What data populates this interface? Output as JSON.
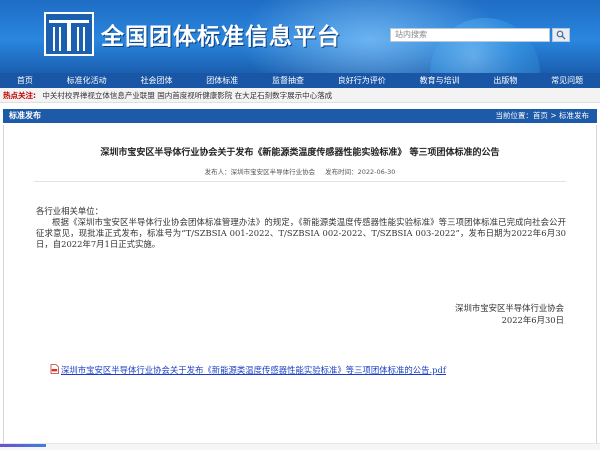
{
  "header": {
    "site_title": "全国团体标准信息平台",
    "search_placeholder": "站内搜索"
  },
  "nav": [
    "首页",
    "标准化活动",
    "社会团体",
    "团体标准",
    "监督抽查",
    "良好行为评价",
    "教育与培训",
    "出版物",
    "常见问题"
  ],
  "hot": {
    "label": "热点关注:",
    "text": "中关村校界禅视立体信息产业联盟  国内首度视听健康影院  在大足石刻数字展示中心落成"
  },
  "section": {
    "title": "标准发布",
    "breadcrumb": "当前位置：首页 > 标准发布"
  },
  "article": {
    "title": "深圳市宝安区半导体行业协会关于发布《新能源类温度传感器性能实验标准》 等三项团体标准的公告",
    "publisher": "发布人：深圳市宝安区半导体行业协会",
    "publish_time": "发布时间：2022-06-30",
    "salutation": "各行业相关单位：",
    "paragraph": "根据《深圳市宝安区半导体行业协会团体标准管理办法》的规定，《新能源类温度传感器性能实验标准》等三项团体标准已完成向社会公开征求意见，现批准正式发布，标准号为“T/SZBSIA 001-2022、T/SZBSIA 002-2022、T/SZBSIA 003-2022”，发布日期为2022年6月30日，自2022年7月1日正式实施。",
    "signature_org": "深圳市宝安区半导体行业协会",
    "signature_date": "2022年6月30日",
    "attachment": "深圳市宝安区半导体行业协会关于发布《新能源类温度传感器性能实验标准》等三项团体标准的公告.pdf"
  },
  "colors": {
    "header_blue": "#2a86de",
    "nav_blue": "#1a56a6",
    "hot_label": "#c00000",
    "link_blue": "#1a3ec4"
  }
}
